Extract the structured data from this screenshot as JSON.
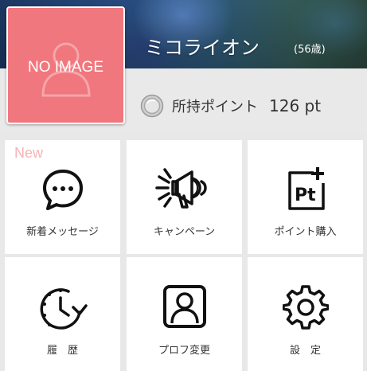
{
  "profile": {
    "avatar_text": "NO IMAGE",
    "name": "ミコライオン",
    "age": "(56歳)"
  },
  "points": {
    "label": "所持ポイント",
    "value": "126 pt"
  },
  "menu": {
    "items": [
      {
        "label": "新着メッセージ",
        "icon": "chat-bubble-icon",
        "badge": "New"
      },
      {
        "label": "キャンペーン",
        "icon": "megaphone-icon"
      },
      {
        "label": "ポイント購入",
        "icon": "points-purchase-icon"
      },
      {
        "label": "履　歴",
        "icon": "history-clock-icon"
      },
      {
        "label": "プロフ変更",
        "icon": "profile-edit-icon"
      },
      {
        "label": "設　定",
        "icon": "gear-icon"
      }
    ]
  },
  "colors": {
    "avatar_bg": "#f0777d",
    "new_badge": "#f7b3b6",
    "tile_bg": "#ffffff",
    "page_bg": "#e8e8e8"
  }
}
